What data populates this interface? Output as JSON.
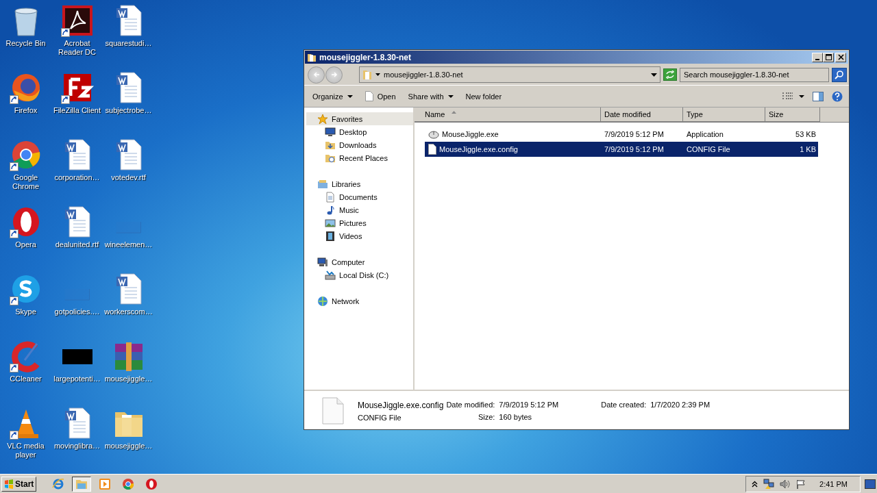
{
  "desktop": {
    "icons": [
      {
        "label": "Recycle Bin",
        "kind": "recycle",
        "shortcut": false
      },
      {
        "label": "Firefox",
        "kind": "firefox",
        "shortcut": true
      },
      {
        "label": "Google Chrome",
        "kind": "chrome",
        "shortcut": true
      },
      {
        "label": "Opera",
        "kind": "opera",
        "shortcut": true
      },
      {
        "label": "Skype",
        "kind": "skype",
        "shortcut": true
      },
      {
        "label": "CCleaner",
        "kind": "ccleaner",
        "shortcut": true
      },
      {
        "label": "VLC media player",
        "kind": "vlc",
        "shortcut": true
      },
      {
        "label": "Acrobat Reader DC",
        "kind": "acrobat",
        "shortcut": true
      },
      {
        "label": "FileZilla Client",
        "kind": "filezilla",
        "shortcut": true
      },
      {
        "label": "corporation…",
        "kind": "word",
        "shortcut": false
      },
      {
        "label": "dealunited.rtf",
        "kind": "word",
        "shortcut": false
      },
      {
        "label": "gotpolicies.…",
        "kind": "blank",
        "shortcut": false
      },
      {
        "label": "largepotenti…",
        "kind": "black",
        "shortcut": false
      },
      {
        "label": "movinglibra…",
        "kind": "word",
        "shortcut": false
      },
      {
        "label": "squarestudi…",
        "kind": "word",
        "shortcut": false
      },
      {
        "label": "subjectrobe…",
        "kind": "word",
        "shortcut": false
      },
      {
        "label": "votedev.rtf",
        "kind": "word",
        "shortcut": false
      },
      {
        "label": "wineelemen…",
        "kind": "blank",
        "shortcut": false
      },
      {
        "label": "workerscom…",
        "kind": "word",
        "shortcut": false
      },
      {
        "label": "mousejiggle…",
        "kind": "winrar",
        "shortcut": false
      },
      {
        "label": "mousejiggle…",
        "kind": "folder",
        "shortcut": false
      }
    ]
  },
  "window": {
    "title": "mousejiggler-1.8.30-net",
    "address": "mousejiggler-1.8.30-net",
    "search": {
      "placeholder": "Search mousejiggler-1.8.30-net"
    },
    "toolbar": [
      {
        "label": "Organize",
        "dropdown": true,
        "kind": "menu"
      },
      {
        "label": "Open",
        "dropdown": false,
        "kind": "open"
      },
      {
        "label": "Share with",
        "dropdown": true,
        "kind": "menu"
      },
      {
        "label": "New folder",
        "dropdown": false,
        "kind": "menu"
      }
    ],
    "sidebar": {
      "items": [
        {
          "label": "Favorites",
          "kind": "star",
          "selected": true,
          "children": [
            {
              "label": "Desktop",
              "kind": "desktop",
              "selected": false
            },
            {
              "label": "Downloads",
              "kind": "downloads",
              "selected": false
            },
            {
              "label": "Recent Places",
              "kind": "recent",
              "selected": false
            }
          ]
        },
        {
          "label": "Libraries",
          "kind": "library",
          "selected": false,
          "children": [
            {
              "label": "Documents",
              "kind": "documents",
              "selected": false
            },
            {
              "label": "Music",
              "kind": "music",
              "selected": false
            },
            {
              "label": "Pictures",
              "kind": "pictures",
              "selected": false
            },
            {
              "label": "Videos",
              "kind": "videos",
              "selected": false
            }
          ]
        },
        {
          "label": "Computer",
          "kind": "computer",
          "selected": false,
          "children": [
            {
              "label": "Local Disk (C:)",
              "kind": "disk",
              "selected": false
            }
          ]
        },
        {
          "label": "Network",
          "kind": "network",
          "selected": false
        }
      ]
    },
    "table": {
      "columns": [
        {
          "label": "Name",
          "sorted": true
        },
        {
          "label": "Date modified",
          "sorted": false
        },
        {
          "label": "Type",
          "sorted": false
        },
        {
          "label": "Size",
          "sorted": false
        }
      ],
      "rows": [
        {
          "name": "MouseJiggle.exe",
          "date_modified": "7/9/2019 5:12 PM",
          "type": "Application",
          "size": "53 KB",
          "kind": "exe",
          "selected": false
        },
        {
          "name": "MouseJiggle.exe.config",
          "date_modified": "7/9/2019 5:12 PM",
          "type": "CONFIG File",
          "size": "1 KB",
          "kind": "file",
          "selected": true
        }
      ]
    },
    "details": {
      "name": "MouseJiggle.exe.config",
      "type": "CONFIG File",
      "fields": [
        {
          "label": "Date modified:",
          "value": "7/9/2019 5:12 PM"
        },
        {
          "label": "Size:",
          "value": "160 bytes"
        },
        {
          "label": "Date created:",
          "value": "1/7/2020 2:39 PM"
        }
      ]
    }
  },
  "taskbar": {
    "start": "Start",
    "apps": [
      {
        "kind": "ie",
        "active": false
      },
      {
        "kind": "explorer",
        "active": true
      },
      {
        "kind": "media",
        "active": false
      },
      {
        "kind": "chrome",
        "active": false
      },
      {
        "kind": "opera",
        "active": false
      }
    ],
    "tray": {
      "time": "2:41 PM"
    }
  }
}
